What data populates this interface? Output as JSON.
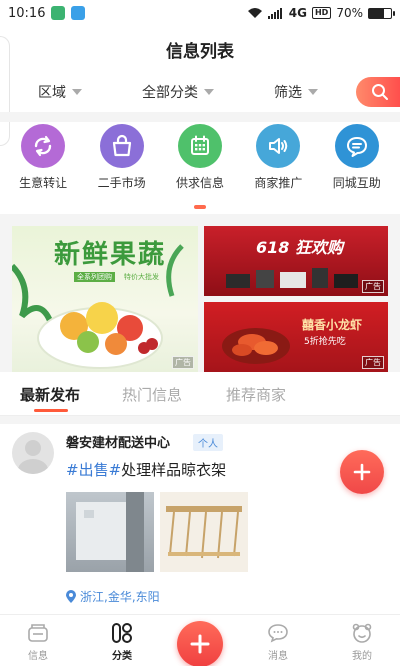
{
  "status_bar": {
    "time": "10:16",
    "network": "4G",
    "hd": "HD",
    "battery_text": "70%",
    "battery_level": 0.7
  },
  "header": {
    "title": "信息列表"
  },
  "filters": {
    "region": "区域",
    "category": "全部分类",
    "filter": "筛选"
  },
  "categories": [
    {
      "label": "生意转让",
      "icon": "transfer-arrows-icon",
      "color": "#b46ad6"
    },
    {
      "label": "二手市场",
      "icon": "shopping-bag-icon",
      "color": "#8b6fd8"
    },
    {
      "label": "供求信息",
      "icon": "calendar-icon",
      "color": "#4fc16b"
    },
    {
      "label": "商家推广",
      "icon": "speaker-icon",
      "color": "#46a7d9"
    },
    {
      "label": "同城互助",
      "icon": "chat-bubble-icon",
      "color": "#2f93d6"
    }
  ],
  "ads": {
    "big": {
      "headline": "新鲜果蔬",
      "sub1": "全系列团购",
      "sub2": "特价大批发"
    },
    "small1": {
      "headline": "618 狂欢购"
    },
    "small2": {
      "headline": "囍香小龙虾",
      "sub": "5折抢先吃"
    },
    "tag": "广告"
  },
  "tabs": [
    {
      "label": "最新发布",
      "active": true
    },
    {
      "label": "热门信息",
      "active": false
    },
    {
      "label": "推荐商家",
      "active": false
    }
  ],
  "post": {
    "name": "磐安建材配送中心",
    "badge": "个人",
    "hashtag": "#出售#",
    "text": "处理样品晾衣架",
    "location": "浙江,金华,东阳"
  },
  "nav": {
    "info": "信息",
    "category": "分类",
    "messages": "消息",
    "mine": "我的"
  },
  "colors": {
    "accent": "#ff5a3a",
    "link": "#4a8ad8"
  }
}
